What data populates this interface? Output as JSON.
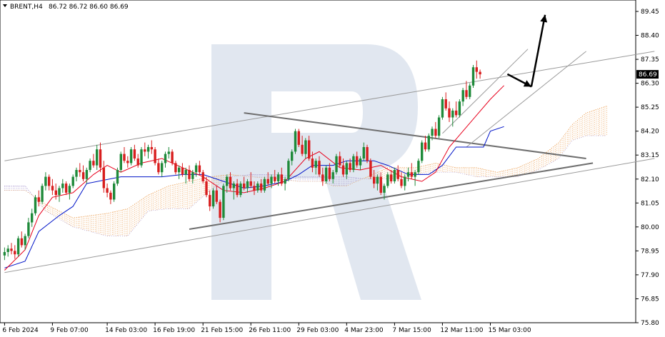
{
  "header": {
    "symbol_label": "BRENT,H4",
    "ohlc_label": "86.72 86.72 86.60 86.69"
  },
  "price_badge": "86.69",
  "colors": {
    "bull": "#1f8a3a",
    "bear": "#d81e1e",
    "tenkan": "#e8001c",
    "kijun": "#0014c8",
    "cloud_up": "#e8913a",
    "cloud_down": "#9a86c8",
    "trend": "#8a8a8a",
    "watermark": "#c9d4e3",
    "arrow": "#000000"
  },
  "icons": {
    "menu": "triangle-down-icon",
    "watermark": "r-logo-icon"
  },
  "chart_data": {
    "type": "candlestick",
    "title": "BRENT,H4",
    "last_price": 86.69,
    "ylim": [
      75.8,
      89.95
    ],
    "y_ticks": [
      "89.45",
      "88.40",
      "87.35",
      "86.30",
      "85.25",
      "84.20",
      "83.15",
      "82.10",
      "81.05",
      "80.00",
      "78.95",
      "77.90",
      "76.85",
      "75.80"
    ],
    "x_ticks": [
      {
        "bar": 0,
        "label": "6 Feb 2024"
      },
      {
        "bar": 14,
        "label": "9 Feb 07:00"
      },
      {
        "bar": 30,
        "label": "14 Feb 03:00"
      },
      {
        "bar": 44,
        "label": "16 Feb 19:00"
      },
      {
        "bar": 58,
        "label": "21 Feb 15:00"
      },
      {
        "bar": 72,
        "label": "26 Feb 11:00"
      },
      {
        "bar": 86,
        "label": "29 Feb 03:00"
      },
      {
        "bar": 100,
        "label": "4 Mar 23:00"
      },
      {
        "bar": 114,
        "label": "7 Mar 15:00"
      },
      {
        "bar": 128,
        "label": "12 Mar 11:00"
      },
      {
        "bar": 142,
        "label": "15 Mar 03:00"
      }
    ],
    "future_bars": 45,
    "grid": false,
    "candles": [
      [
        78.75,
        79.1,
        78.55,
        78.9
      ],
      [
        78.9,
        79.2,
        78.7,
        79.05
      ],
      [
        79.05,
        79.3,
        78.8,
        78.95
      ],
      [
        78.95,
        79.2,
        78.6,
        78.8
      ],
      [
        78.8,
        79.6,
        78.7,
        79.5
      ],
      [
        79.5,
        79.8,
        79.1,
        79.2
      ],
      [
        79.2,
        79.7,
        79.0,
        79.6
      ],
      [
        79.6,
        80.4,
        79.5,
        80.2
      ],
      [
        80.2,
        80.8,
        80.0,
        80.6
      ],
      [
        80.6,
        81.4,
        80.5,
        81.3
      ],
      [
        81.3,
        81.6,
        80.9,
        81.1
      ],
      [
        81.1,
        81.9,
        81.0,
        81.8
      ],
      [
        81.8,
        82.4,
        81.6,
        82.2
      ],
      [
        82.2,
        82.3,
        81.6,
        81.8
      ],
      [
        81.8,
        82.1,
        81.4,
        81.6
      ],
      [
        81.6,
        81.9,
        81.2,
        81.4
      ],
      [
        81.4,
        81.8,
        81.1,
        81.7
      ],
      [
        81.7,
        82.1,
        81.5,
        81.9
      ],
      [
        81.9,
        82.0,
        81.4,
        81.5
      ],
      [
        81.5,
        81.9,
        81.2,
        81.8
      ],
      [
        81.8,
        82.3,
        81.7,
        82.2
      ],
      [
        82.2,
        82.6,
        82.0,
        82.5
      ],
      [
        82.5,
        82.8,
        82.2,
        82.4
      ],
      [
        82.4,
        82.7,
        82.0,
        82.1
      ],
      [
        82.1,
        82.6,
        81.9,
        82.5
      ],
      [
        82.5,
        83.0,
        82.4,
        82.9
      ],
      [
        82.9,
        83.2,
        82.6,
        82.7
      ],
      [
        82.7,
        83.6,
        82.5,
        83.4
      ],
      [
        83.4,
        83.7,
        82.4,
        82.6
      ],
      [
        82.6,
        82.9,
        81.5,
        81.7
      ],
      [
        81.7,
        81.9,
        81.3,
        81.5
      ],
      [
        81.5,
        81.6,
        81.0,
        81.2
      ],
      [
        81.2,
        82.0,
        81.1,
        81.9
      ],
      [
        81.9,
        82.6,
        81.8,
        82.5
      ],
      [
        82.5,
        83.3,
        82.4,
        83.2
      ],
      [
        83.2,
        83.5,
        82.8,
        82.9
      ],
      [
        82.9,
        83.1,
        82.6,
        82.8
      ],
      [
        82.8,
        83.5,
        82.7,
        83.4
      ],
      [
        83.4,
        83.6,
        82.9,
        83.0
      ],
      [
        83.0,
        83.2,
        82.6,
        82.7
      ],
      [
        82.7,
        83.5,
        82.6,
        83.4
      ],
      [
        83.4,
        83.7,
        83.1,
        83.3
      ],
      [
        83.3,
        83.6,
        83.0,
        83.5
      ],
      [
        83.5,
        83.8,
        83.2,
        83.4
      ],
      [
        83.4,
        83.5,
        82.7,
        82.8
      ],
      [
        82.8,
        83.0,
        82.3,
        82.4
      ],
      [
        82.4,
        82.9,
        82.2,
        82.8
      ],
      [
        82.8,
        83.3,
        82.6,
        83.2
      ],
      [
        83.2,
        83.5,
        83.0,
        83.3
      ],
      [
        83.3,
        83.4,
        82.7,
        82.8
      ],
      [
        82.8,
        82.9,
        82.3,
        82.4
      ],
      [
        82.4,
        82.7,
        82.1,
        82.6
      ],
      [
        82.6,
        82.8,
        82.2,
        82.3
      ],
      [
        82.3,
        82.6,
        81.9,
        82.5
      ],
      [
        82.5,
        82.7,
        82.0,
        82.1
      ],
      [
        82.1,
        82.5,
        81.9,
        82.4
      ],
      [
        82.4,
        82.8,
        82.2,
        82.7
      ],
      [
        82.7,
        82.9,
        82.3,
        82.4
      ],
      [
        82.4,
        82.5,
        81.9,
        82.0
      ],
      [
        82.0,
        82.2,
        81.3,
        81.4
      ],
      [
        81.4,
        81.6,
        80.7,
        80.9
      ],
      [
        80.9,
        81.7,
        80.8,
        81.6
      ],
      [
        81.6,
        81.8,
        81.0,
        81.1
      ],
      [
        81.1,
        81.2,
        80.2,
        80.4
      ],
      [
        80.4,
        81.9,
        80.3,
        81.8
      ],
      [
        81.8,
        82.3,
        81.5,
        82.2
      ],
      [
        82.2,
        82.4,
        81.6,
        81.7
      ],
      [
        81.7,
        82.0,
        81.2,
        81.9
      ],
      [
        81.9,
        82.1,
        81.3,
        81.4
      ],
      [
        81.4,
        82.0,
        81.3,
        81.9
      ],
      [
        81.9,
        82.2,
        81.6,
        81.7
      ],
      [
        81.7,
        82.1,
        81.5,
        82.0
      ],
      [
        82.0,
        82.4,
        81.7,
        81.8
      ],
      [
        81.8,
        82.0,
        81.4,
        81.6
      ],
      [
        81.6,
        82.0,
        81.5,
        81.9
      ],
      [
        81.9,
        82.1,
        81.5,
        81.6
      ],
      [
        81.6,
        82.2,
        81.5,
        82.1
      ],
      [
        82.1,
        82.4,
        81.8,
        81.9
      ],
      [
        81.9,
        82.3,
        81.7,
        82.2
      ],
      [
        82.2,
        82.5,
        81.9,
        82.0
      ],
      [
        82.0,
        82.4,
        81.8,
        82.3
      ],
      [
        82.3,
        82.6,
        81.8,
        81.9
      ],
      [
        81.9,
        82.2,
        81.6,
        82.1
      ],
      [
        82.1,
        83.0,
        82.0,
        82.9
      ],
      [
        82.9,
        83.4,
        82.7,
        83.3
      ],
      [
        83.3,
        84.3,
        83.2,
        84.2
      ],
      [
        84.2,
        84.3,
        83.5,
        83.6
      ],
      [
        83.6,
        84.0,
        83.1,
        83.2
      ],
      [
        83.2,
        83.9,
        83.0,
        83.8
      ],
      [
        83.8,
        84.0,
        82.9,
        83.0
      ],
      [
        83.0,
        83.3,
        82.4,
        82.6
      ],
      [
        82.6,
        83.0,
        82.3,
        82.9
      ],
      [
        82.9,
        83.1,
        82.2,
        82.3
      ],
      [
        82.3,
        82.6,
        81.8,
        82.0
      ],
      [
        82.0,
        82.7,
        81.9,
        82.6
      ],
      [
        82.6,
        82.8,
        82.0,
        82.1
      ],
      [
        82.1,
        82.5,
        81.9,
        82.4
      ],
      [
        82.4,
        83.2,
        82.3,
        83.1
      ],
      [
        83.1,
        83.3,
        82.6,
        82.7
      ],
      [
        82.7,
        83.0,
        82.2,
        82.3
      ],
      [
        82.3,
        82.9,
        82.1,
        82.8
      ],
      [
        82.8,
        83.0,
        82.4,
        82.5
      ],
      [
        82.5,
        83.2,
        82.4,
        83.1
      ],
      [
        83.1,
        83.3,
        82.6,
        82.7
      ],
      [
        82.7,
        83.1,
        82.5,
        83.0
      ],
      [
        83.0,
        83.7,
        82.9,
        83.5
      ],
      [
        83.5,
        83.6,
        82.8,
        82.9
      ],
      [
        82.9,
        83.0,
        82.1,
        82.2
      ],
      [
        82.2,
        82.5,
        81.7,
        81.9
      ],
      [
        81.9,
        82.3,
        81.6,
        82.2
      ],
      [
        82.2,
        82.4,
        81.4,
        81.5
      ],
      [
        81.5,
        81.9,
        81.2,
        81.8
      ],
      [
        81.8,
        82.4,
        81.7,
        82.3
      ],
      [
        82.3,
        82.5,
        81.9,
        82.0
      ],
      [
        82.0,
        82.6,
        81.9,
        82.5
      ],
      [
        82.5,
        82.7,
        82.0,
        82.1
      ],
      [
        82.1,
        82.4,
        81.7,
        81.8
      ],
      [
        81.8,
        82.3,
        81.6,
        82.2
      ],
      [
        82.2,
        82.6,
        82.0,
        82.4
      ],
      [
        82.4,
        82.8,
        82.1,
        82.2
      ],
      [
        82.2,
        82.5,
        81.8,
        82.4
      ],
      [
        82.4,
        83.0,
        82.3,
        82.9
      ],
      [
        82.9,
        83.8,
        82.8,
        83.7
      ],
      [
        83.7,
        84.0,
        83.3,
        83.4
      ],
      [
        83.4,
        84.1,
        83.3,
        84.0
      ],
      [
        84.0,
        84.4,
        83.8,
        84.3
      ],
      [
        84.3,
        84.6,
        83.9,
        84.0
      ],
      [
        84.0,
        84.9,
        83.9,
        84.8
      ],
      [
        84.8,
        85.7,
        84.7,
        85.6
      ],
      [
        85.6,
        85.9,
        85.1,
        85.2
      ],
      [
        85.2,
        85.5,
        84.6,
        84.8
      ],
      [
        84.8,
        85.2,
        84.4,
        85.1
      ],
      [
        85.1,
        85.5,
        84.8,
        84.9
      ],
      [
        84.9,
        85.6,
        84.8,
        85.5
      ],
      [
        85.5,
        86.1,
        85.3,
        86.0
      ],
      [
        86.0,
        86.4,
        85.6,
        85.7
      ],
      [
        85.7,
        86.3,
        85.6,
        86.2
      ],
      [
        86.2,
        87.1,
        86.1,
        87.0
      ],
      [
        87.0,
        87.3,
        86.5,
        86.8
      ],
      [
        86.8,
        86.9,
        86.5,
        86.69
      ]
    ],
    "tenkan": [
      [
        0,
        78.1
      ],
      [
        6,
        79.0
      ],
      [
        10,
        80.5
      ],
      [
        14,
        81.3
      ],
      [
        20,
        81.5
      ],
      [
        26,
        82.3
      ],
      [
        30,
        82.7
      ],
      [
        34,
        82.4
      ],
      [
        40,
        82.8
      ],
      [
        46,
        83.0
      ],
      [
        52,
        82.6
      ],
      [
        58,
        82.2
      ],
      [
        64,
        81.6
      ],
      [
        70,
        81.5
      ],
      [
        76,
        81.7
      ],
      [
        82,
        82.0
      ],
      [
        88,
        83.0
      ],
      [
        92,
        83.3
      ],
      [
        98,
        82.6
      ],
      [
        104,
        82.5
      ],
      [
        110,
        82.7
      ],
      [
        116,
        82.2
      ],
      [
        122,
        82.0
      ],
      [
        126,
        82.4
      ],
      [
        130,
        83.5
      ],
      [
        134,
        84.2
      ],
      [
        138,
        84.9
      ],
      [
        142,
        85.6
      ],
      [
        146,
        86.2
      ]
    ],
    "kijun": [
      [
        0,
        78.2
      ],
      [
        6,
        78.5
      ],
      [
        10,
        79.8
      ],
      [
        16,
        80.5
      ],
      [
        20,
        80.9
      ],
      [
        24,
        81.9
      ],
      [
        34,
        82.2
      ],
      [
        46,
        82.2
      ],
      [
        52,
        82.3
      ],
      [
        58,
        82.3
      ],
      [
        64,
        82.0
      ],
      [
        70,
        81.7
      ],
      [
        76,
        81.8
      ],
      [
        82,
        82.0
      ],
      [
        86,
        82.3
      ],
      [
        90,
        82.7
      ],
      [
        96,
        82.7
      ],
      [
        100,
        82.9
      ],
      [
        108,
        82.9
      ],
      [
        112,
        82.7
      ],
      [
        118,
        82.3
      ],
      [
        124,
        82.3
      ],
      [
        128,
        82.7
      ],
      [
        132,
        83.5
      ],
      [
        140,
        83.5
      ],
      [
        142,
        84.2
      ],
      [
        146,
        84.4
      ]
    ],
    "cloud": {
      "senkou_a": [
        [
          0,
          81.6
        ],
        [
          6,
          81.6
        ],
        [
          12,
          81.0
        ],
        [
          20,
          80.4
        ],
        [
          30,
          80.6
        ],
        [
          36,
          80.8
        ],
        [
          42,
          81.4
        ],
        [
          48,
          81.8
        ],
        [
          54,
          82.0
        ],
        [
          60,
          82.2
        ],
        [
          66,
          82.3
        ],
        [
          72,
          82.2
        ],
        [
          80,
          82.1
        ],
        [
          86,
          82.0
        ],
        [
          92,
          82.0
        ],
        [
          96,
          81.8
        ],
        [
          100,
          81.8
        ],
        [
          106,
          82.2
        ],
        [
          112,
          82.6
        ],
        [
          120,
          82.6
        ],
        [
          126,
          82.8
        ],
        [
          132,
          82.6
        ],
        [
          138,
          82.6
        ],
        [
          144,
          82.4
        ],
        [
          150,
          82.6
        ],
        [
          156,
          83.0
        ],
        [
          162,
          83.7
        ],
        [
          166,
          84.5
        ],
        [
          170,
          85.0
        ],
        [
          176,
          85.3
        ]
      ],
      "senkou_b": [
        [
          0,
          81.8
        ],
        [
          6,
          81.8
        ],
        [
          12,
          80.7
        ],
        [
          20,
          80.0
        ],
        [
          30,
          79.6
        ],
        [
          36,
          79.6
        ],
        [
          42,
          80.7
        ],
        [
          48,
          80.8
        ],
        [
          54,
          80.8
        ],
        [
          60,
          81.6
        ],
        [
          66,
          82.2
        ],
        [
          72,
          82.3
        ],
        [
          80,
          82.3
        ],
        [
          86,
          82.2
        ],
        [
          92,
          82.2
        ],
        [
          96,
          82.2
        ],
        [
          100,
          82.2
        ],
        [
          106,
          82.1
        ],
        [
          112,
          82.1
        ],
        [
          120,
          82.3
        ],
        [
          126,
          82.4
        ],
        [
          132,
          82.4
        ],
        [
          138,
          82.2
        ],
        [
          144,
          82.2
        ],
        [
          150,
          82.2
        ],
        [
          156,
          82.5
        ],
        [
          162,
          83.0
        ],
        [
          166,
          83.8
        ],
        [
          170,
          84.0
        ],
        [
          176,
          84.0
        ]
      ]
    },
    "trendlines": [
      {
        "name": "channel-upper",
        "from": [
          0,
          82.9
        ],
        "to": [
          190,
          87.7
        ],
        "width": 1
      },
      {
        "name": "channel-lower",
        "from": [
          0,
          78.0
        ],
        "to": [
          190,
          83.0
        ],
        "width": 1
      },
      {
        "name": "triangle-top",
        "from": [
          70,
          85.0
        ],
        "to": [
          170,
          83.0
        ],
        "width": 2
      },
      {
        "name": "triangle-bottom",
        "from": [
          54,
          79.9
        ],
        "to": [
          172,
          82.8
        ],
        "width": 2
      },
      {
        "name": "short-channel-upper",
        "from": [
          128,
          84.1
        ],
        "to": [
          153,
          87.8
        ],
        "width": 1
      },
      {
        "name": "short-channel-lower",
        "from": [
          135,
          83.5
        ],
        "to": [
          170,
          87.7
        ],
        "width": 1
      }
    ],
    "forecast_arrows": [
      {
        "name": "arrow-down",
        "from": [
          147,
          86.7
        ],
        "to": [
          154,
          86.15
        ]
      },
      {
        "name": "arrow-up",
        "from": [
          154,
          86.15
        ],
        "to": [
          158,
          89.3
        ]
      }
    ]
  }
}
